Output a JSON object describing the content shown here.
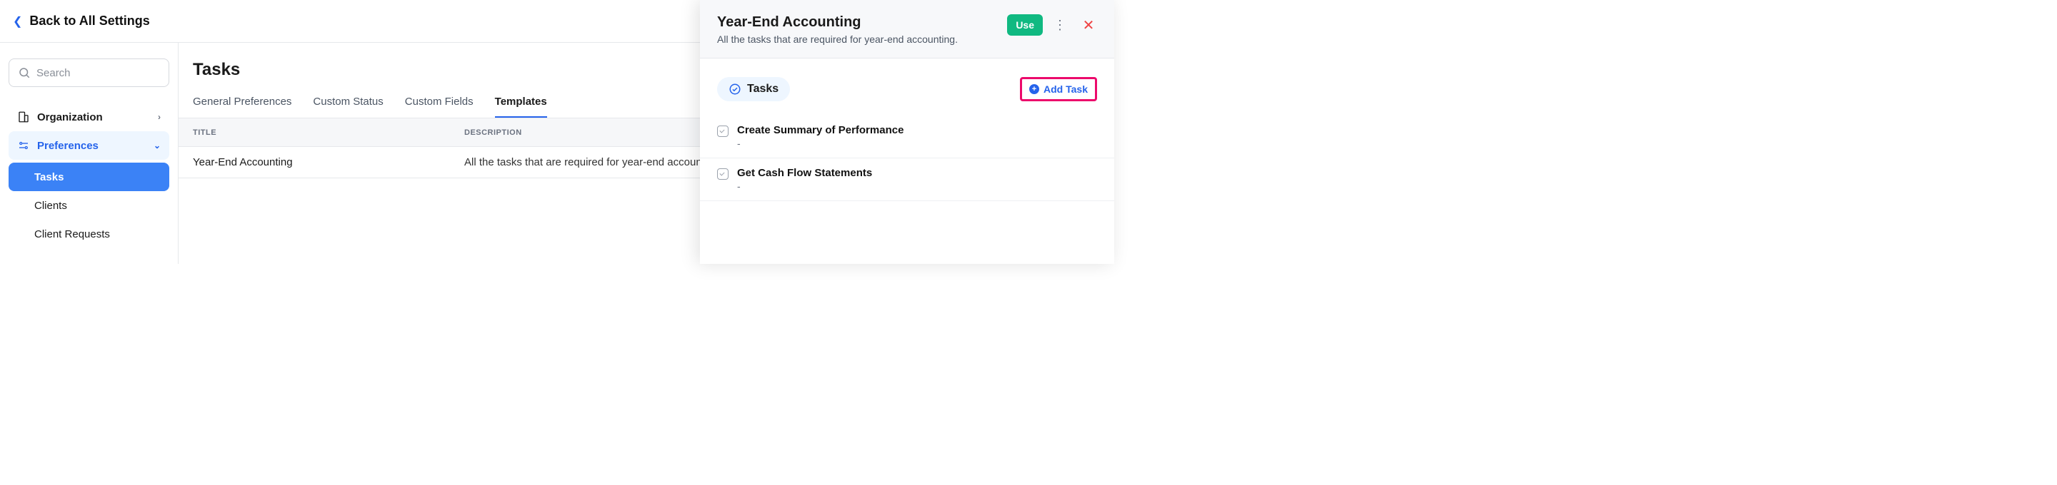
{
  "back": {
    "label": "Back to All Settings"
  },
  "search": {
    "placeholder": "Search"
  },
  "sidebar": {
    "org": {
      "label": "Organization"
    },
    "pref": {
      "label": "Preferences",
      "children": [
        {
          "label": "Tasks",
          "active": true
        },
        {
          "label": "Clients"
        },
        {
          "label": "Client Requests"
        }
      ]
    }
  },
  "main": {
    "heading": "Tasks",
    "tabs": [
      {
        "label": "General Preferences"
      },
      {
        "label": "Custom Status"
      },
      {
        "label": "Custom Fields"
      },
      {
        "label": "Templates",
        "active": true
      }
    ],
    "columns": {
      "title": "TITLE",
      "description": "DESCRIPTION"
    },
    "rows": [
      {
        "title": "Year-End Accounting",
        "description": "All the tasks that are required for year-end accounting."
      }
    ]
  },
  "panel": {
    "title": "Year-End Accounting",
    "subtitle": "All the tasks that are required for year-end accounting.",
    "use_label": "Use",
    "pill_label": "Tasks",
    "add_task_label": "Add Task",
    "tasks": [
      {
        "title": "Create Summary of Performance",
        "desc": "-"
      },
      {
        "title": "Get Cash Flow Statements",
        "desc": "-"
      }
    ]
  }
}
